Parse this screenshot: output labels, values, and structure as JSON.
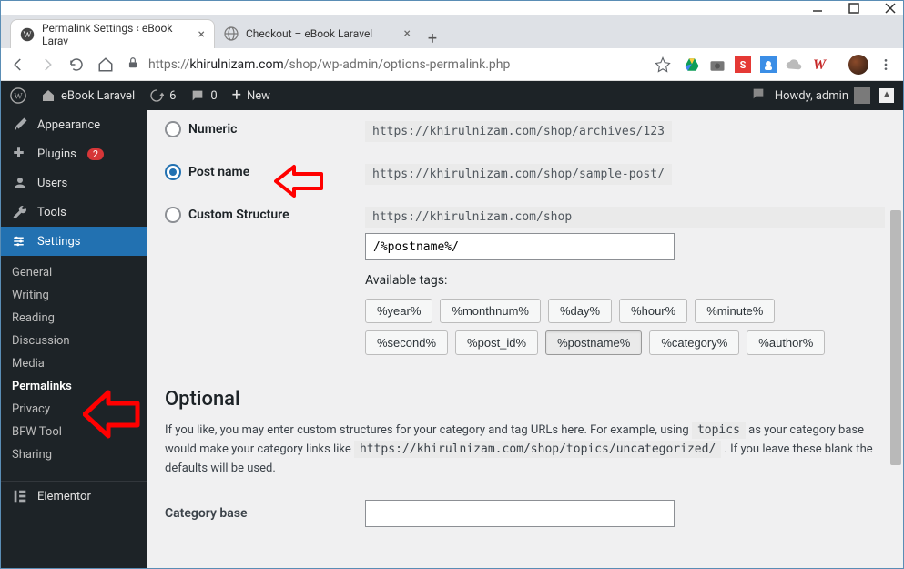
{
  "browser": {
    "tabs": [
      {
        "title": "Permalink Settings ‹ eBook Larav"
      },
      {
        "title": "Checkout – eBook Laravel"
      }
    ],
    "url": {
      "scheme": "https://",
      "domain": "khirulnizam.com",
      "path": "/shop/wp-admin/options-permalink.php"
    }
  },
  "adminbar": {
    "site": "eBook Laravel",
    "updates": "6",
    "comments": "0",
    "new": "New",
    "howdy": "Howdy, admin"
  },
  "sidebar": {
    "appearance": "Appearance",
    "plugins": "Plugins",
    "plugins_count": "2",
    "users": "Users",
    "tools": "Tools",
    "settings": "Settings",
    "sub": {
      "general": "General",
      "writing": "Writing",
      "reading": "Reading",
      "discussion": "Discussion",
      "media": "Media",
      "permalinks": "Permalinks",
      "privacy": "Privacy",
      "bfw": "BFW Tool",
      "sharing": "Sharing"
    },
    "elementor": "Elementor"
  },
  "permalink": {
    "numeric_label": "Numeric",
    "numeric_url": "https://khirulnizam.com/shop/archives/123",
    "postname_label": "Post name",
    "postname_url": "https://khirulnizam.com/shop/sample-post/",
    "custom_label": "Custom Structure",
    "custom_base": "https://khirulnizam.com/shop",
    "custom_value": "/%postname%/",
    "available_label": "Available tags:",
    "tags": [
      "%year%",
      "%monthnum%",
      "%day%",
      "%hour%",
      "%minute%",
      "%second%",
      "%post_id%",
      "%postname%",
      "%category%",
      "%author%"
    ],
    "optional_heading": "Optional",
    "optional_desc_1": "If you like, you may enter custom structures for your category and tag URLs here. For example, using ",
    "optional_code_1": "topics",
    "optional_desc_2": " as your category base would make your category links like ",
    "optional_code_2": "https://khirulnizam.com/shop/topics/uncategorized/",
    "optional_desc_3": " . If you leave these blank the defaults will be used.",
    "category_base_label": "Category base"
  }
}
